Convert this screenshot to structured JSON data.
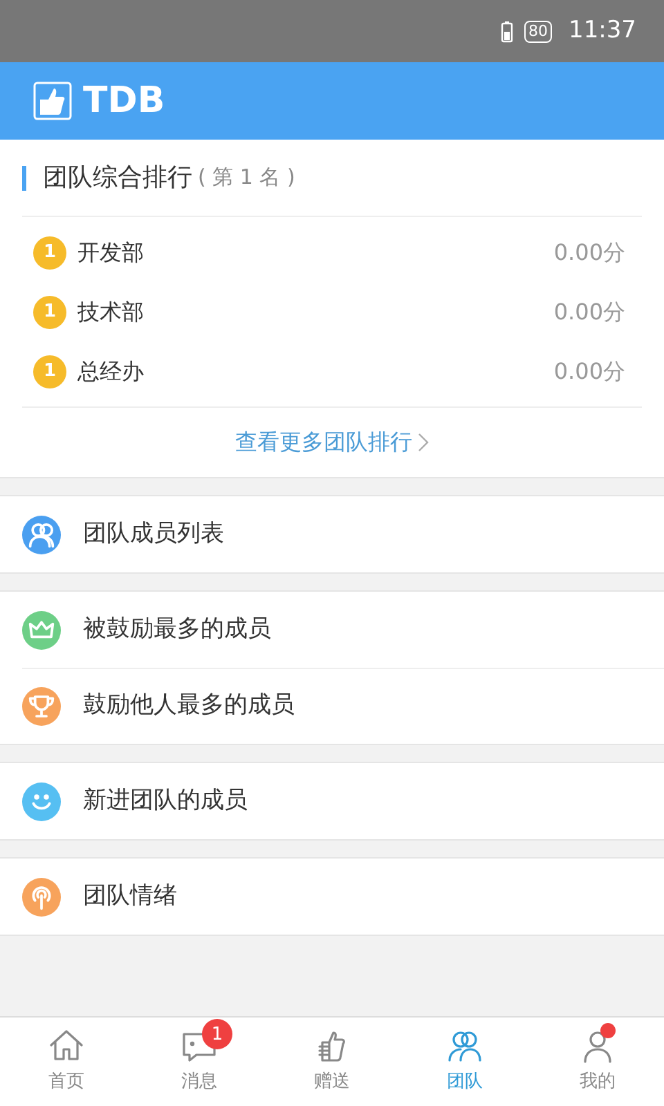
{
  "status_bar": {
    "battery": "80",
    "time": "11:37"
  },
  "header": {
    "title": "TDB"
  },
  "ranking": {
    "title": "团队综合排行",
    "subtitle": "( 第 1 名 )",
    "rows": [
      {
        "rank": "1",
        "name": "开发部",
        "score": "0.00分"
      },
      {
        "rank": "1",
        "name": "技术部",
        "score": "0.00分"
      },
      {
        "rank": "1",
        "name": "总经办",
        "score": "0.00分"
      }
    ],
    "more_link": "查看更多团队排行"
  },
  "menu_groups": [
    {
      "items": [
        {
          "kind": "people",
          "color": "#4a9ff0",
          "label": "团队成员列表"
        }
      ]
    },
    {
      "items": [
        {
          "kind": "crown",
          "color": "#6dcf87",
          "label": "被鼓励最多的成员"
        },
        {
          "kind": "trophy",
          "color": "#f7a35c",
          "label": "鼓励他人最多的成员"
        }
      ]
    },
    {
      "items": [
        {
          "kind": "smile",
          "color": "#56bff2",
          "label": "新进团队的成员"
        }
      ]
    },
    {
      "items": [
        {
          "kind": "signal",
          "color": "#f7a35c",
          "label": "团队情绪"
        }
      ]
    }
  ],
  "tabs": [
    {
      "kind": "home",
      "label": "首页",
      "selected": false
    },
    {
      "kind": "message",
      "label": "消息",
      "selected": false,
      "badge": "1"
    },
    {
      "kind": "thumb",
      "label": "赠送",
      "selected": false
    },
    {
      "kind": "team",
      "label": "团队",
      "selected": true
    },
    {
      "kind": "user",
      "label": "我的",
      "selected": false,
      "dot": true
    }
  ]
}
